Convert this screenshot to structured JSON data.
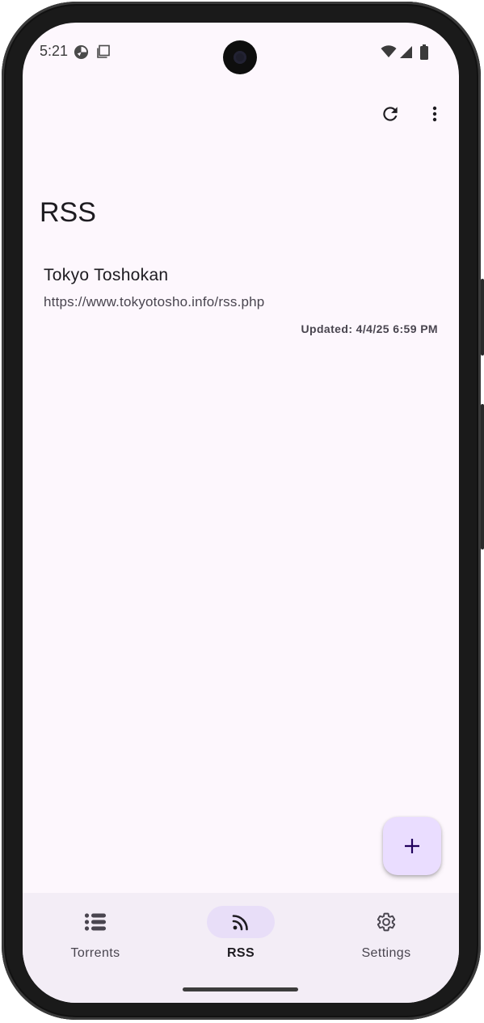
{
  "status_bar": {
    "time": "5:21",
    "icons": [
      "data-saver-icon",
      "screenshot-icon",
      "wifi-icon",
      "signal-icon",
      "battery-icon"
    ]
  },
  "toolbar": {
    "actions": [
      "refresh-icon",
      "more-vert-icon"
    ]
  },
  "page": {
    "title": "RSS"
  },
  "feeds": [
    {
      "name": "Tokyo Toshokan",
      "url": "https://www.tokyotosho.info/rss.php",
      "updated": "Updated: 4/4/25 6:59 PM"
    }
  ],
  "fab": {
    "icon": "add-icon"
  },
  "bottom_nav": {
    "items": [
      {
        "label": "Torrents",
        "icon": "list-icon",
        "active": false
      },
      {
        "label": "RSS",
        "icon": "rss-icon",
        "active": true
      },
      {
        "label": "Settings",
        "icon": "gear-icon",
        "active": false
      }
    ]
  },
  "colors": {
    "background": "#fdf7fd",
    "nav_background": "#f3edf6",
    "active_indicator": "#e8def8",
    "fab": "#eaddff",
    "text_primary": "#1d1b20",
    "text_secondary": "#49454f"
  }
}
